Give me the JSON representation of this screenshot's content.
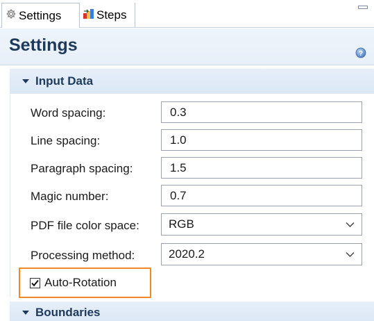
{
  "tabs": [
    {
      "label": "Settings",
      "icon": "gear-icon",
      "active": true
    },
    {
      "label": "Steps",
      "icon": "steps-icon",
      "active": false
    }
  ],
  "header": {
    "title": "Settings",
    "help_icon": "help-icon"
  },
  "sections": {
    "input_data": {
      "label": "Input Data",
      "expanded": true
    },
    "boundaries": {
      "label": "Boundaries",
      "expanded": true
    }
  },
  "form": {
    "word_spacing": {
      "label": "Word spacing:",
      "value": "0.3"
    },
    "line_spacing": {
      "label": "Line spacing:",
      "value": "1.0"
    },
    "paragraph_spacing": {
      "label": "Paragraph spacing:",
      "value": "1.5"
    },
    "magic_number": {
      "label": "Magic number:",
      "value": "0.7"
    },
    "pdf_color_space": {
      "label": "PDF file color space:",
      "value": "RGB"
    },
    "processing_method": {
      "label": "Processing method:",
      "value": "2020.2"
    },
    "auto_rotation": {
      "label": "Auto-Rotation",
      "checked": true
    }
  },
  "colors": {
    "accent_highlight": "#f08a24",
    "title_text": "#1d3a5c",
    "section_header_bg": "#dbe7f5"
  }
}
